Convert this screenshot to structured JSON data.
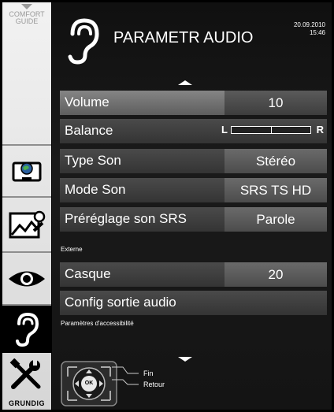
{
  "sidebar": {
    "comfort_line1": "COMFORT",
    "comfort_line2": "GUIDE",
    "icons": [
      "monitor-icon",
      "picture-icon",
      "eye-icon",
      "ear-icon",
      "tools-icon"
    ],
    "active": "ear-icon",
    "brand": "GRUNDIG"
  },
  "header": {
    "title": "PARAMETR AUDIO",
    "date": "20.09.2010",
    "time": "15:46",
    "icon": "ear-icon"
  },
  "menu": {
    "volume": {
      "label": "Volume",
      "value": "10"
    },
    "balance": {
      "label": "Balance",
      "left": "L",
      "right": "R",
      "position": 0.5
    },
    "type_son": {
      "label": "Type Son",
      "value": "Stéréo"
    },
    "mode_son": {
      "label": "Mode Son",
      "value": "SRS TS HD"
    },
    "preset_srs": {
      "label": "Préréglage son SRS",
      "value": "Parole"
    },
    "section_externe": "Externe",
    "casque": {
      "label": "Casque",
      "value": "20"
    },
    "config_sortie": {
      "label": "Config sortie audio"
    },
    "section_accessibility": "Paramètres d'accessibilité",
    "selected": "volume"
  },
  "remote": {
    "ok_label": "OK",
    "fin_label": "Fin",
    "retour_label": "Retour"
  },
  "colors": {
    "panel": "#141414",
    "row": "#3c3c3c",
    "row_selected": "#767676",
    "value_box": "#5a5a5a",
    "sidebar": "#e6e6e6",
    "text": "#ffffff"
  }
}
